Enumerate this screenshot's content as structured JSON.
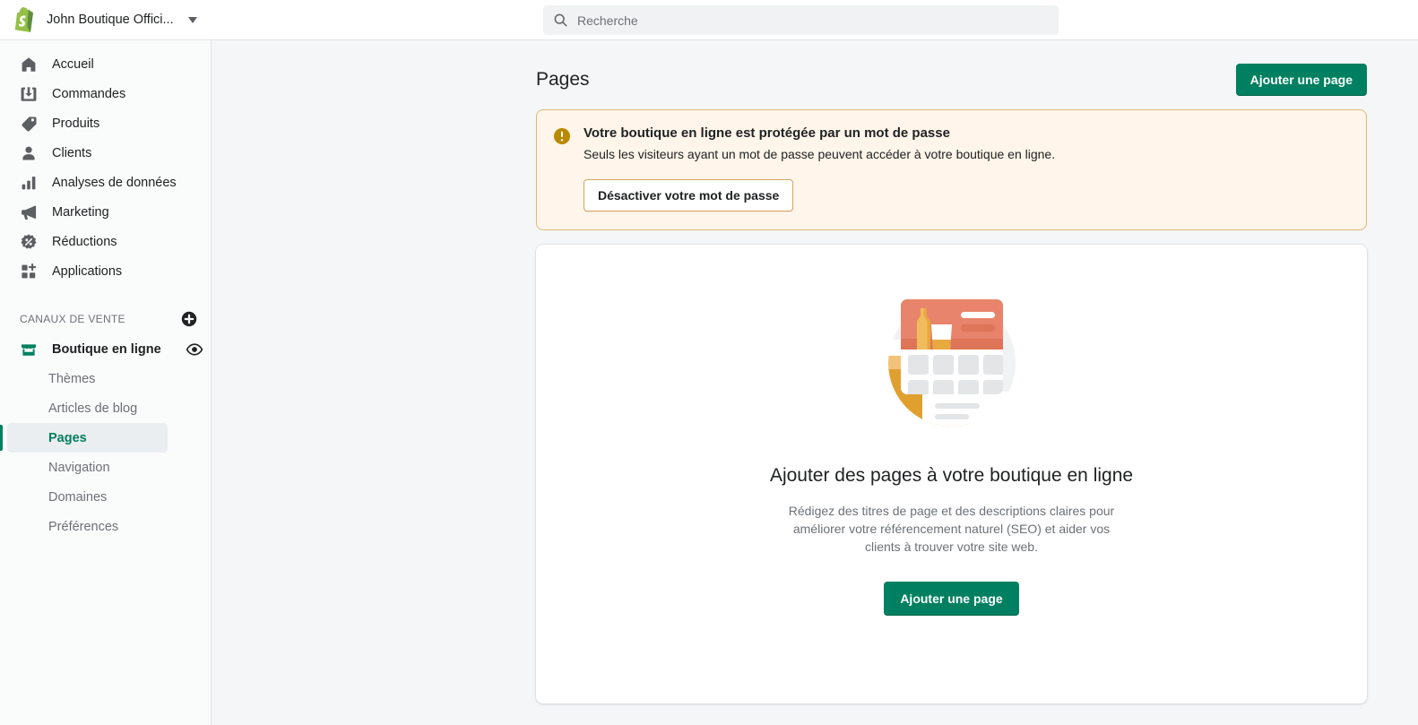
{
  "topbar": {
    "logo_icon": "shopify-bag-icon",
    "store_name": "John Boutique Offici...",
    "caret_icon": "chevron-down-icon",
    "search": {
      "icon": "search-icon",
      "placeholder": "Recherche",
      "value": ""
    }
  },
  "sidebar": {
    "items": [
      {
        "label": "Accueil",
        "icon": "home-icon"
      },
      {
        "label": "Commandes",
        "icon": "orders-inbox-icon"
      },
      {
        "label": "Produits",
        "icon": "product-tag-icon"
      },
      {
        "label": "Clients",
        "icon": "customer-person-icon"
      },
      {
        "label": "Analyses de données",
        "icon": "analytics-bar-chart-icon"
      },
      {
        "label": "Marketing",
        "icon": "marketing-megaphone-icon"
      },
      {
        "label": "Réductions",
        "icon": "discount-badge-icon"
      },
      {
        "label": "Applications",
        "icon": "apps-grid-icon"
      }
    ],
    "section": {
      "title": "CANAUX DE VENTE",
      "add_icon": "plus-circle-icon"
    },
    "channel": {
      "label": "Boutique en ligne",
      "icon": "online-store-icon",
      "view_icon": "eye-icon"
    },
    "sub_items": [
      {
        "label": "Thèmes",
        "active": false
      },
      {
        "label": "Articles de blog",
        "active": false
      },
      {
        "label": "Pages",
        "active": true
      },
      {
        "label": "Navigation",
        "active": false
      },
      {
        "label": "Domaines",
        "active": false
      },
      {
        "label": "Préférences",
        "active": false
      }
    ]
  },
  "main": {
    "page_title": "Pages",
    "add_page_button": "Ajouter une page",
    "banner": {
      "icon": "alert-exclamation-icon",
      "title": "Votre boutique en ligne est protégée par un mot de passe",
      "text": "Seuls les visiteurs ayant un mot de passe peuvent accéder à votre boutique en ligne.",
      "button": "Désactiver votre mot de passe"
    },
    "empty_state": {
      "illustration": "online-store-page-illustration",
      "title": "Ajouter des pages à votre boutique en ligne",
      "text": "Rédigez des titres de page et des descriptions claires pour améliorer votre référencement naturel (SEO) et aider vos clients à trouver votre site web.",
      "button": "Ajouter une page"
    }
  },
  "colors": {
    "brand_green": "#008060",
    "logo_green": "#95BF47",
    "warning_border": "#E1B878",
    "warning_bg": "#FFF5EA",
    "warning_icon": "#B98900",
    "illus_coral": "#E8846B",
    "illus_amber": "#E0A030"
  }
}
